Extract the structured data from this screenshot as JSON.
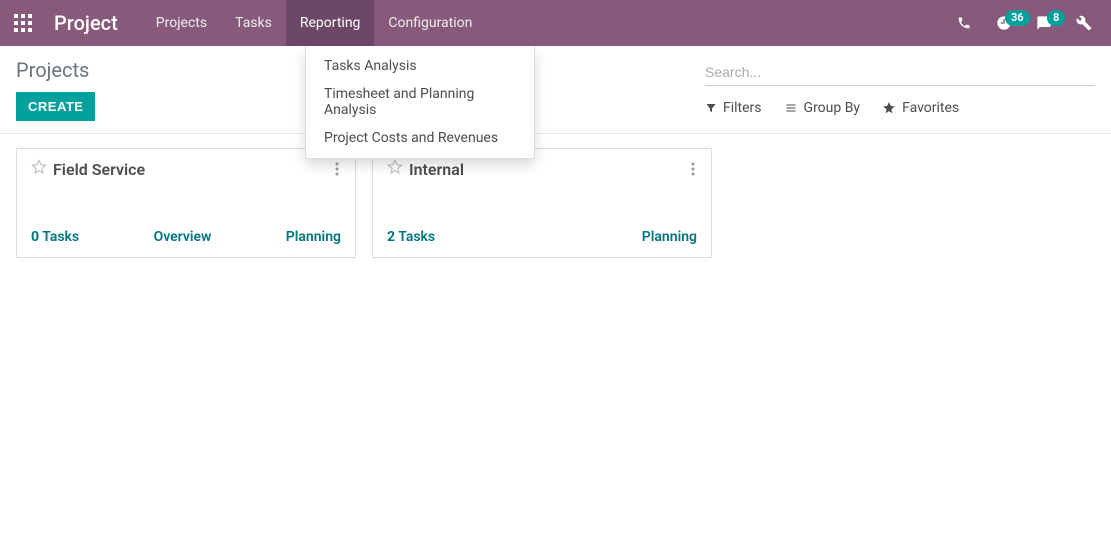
{
  "topbar": {
    "brand": "Project",
    "nav": [
      {
        "label": "Projects",
        "active": false
      },
      {
        "label": "Tasks",
        "active": false
      },
      {
        "label": "Reporting",
        "active": true
      },
      {
        "label": "Configuration",
        "active": false
      }
    ],
    "clock_badge": "36",
    "chat_badge": "8"
  },
  "dropdown": {
    "items": [
      "Tasks Analysis",
      "Timesheet and Planning Analysis",
      "Project Costs and Revenues"
    ]
  },
  "controlbar": {
    "breadcrumb": "Projects",
    "create_label": "CREATE",
    "search_placeholder": "Search...",
    "filters_label": "Filters",
    "groupby_label": "Group By",
    "favorites_label": "Favorites"
  },
  "projects": [
    {
      "title": "Field Service",
      "task_count": "0",
      "task_label": "Tasks",
      "links": [
        "Overview",
        "Planning"
      ]
    },
    {
      "title": "Internal",
      "task_count": "2",
      "task_label": "Tasks",
      "links": [
        "Planning"
      ]
    }
  ]
}
